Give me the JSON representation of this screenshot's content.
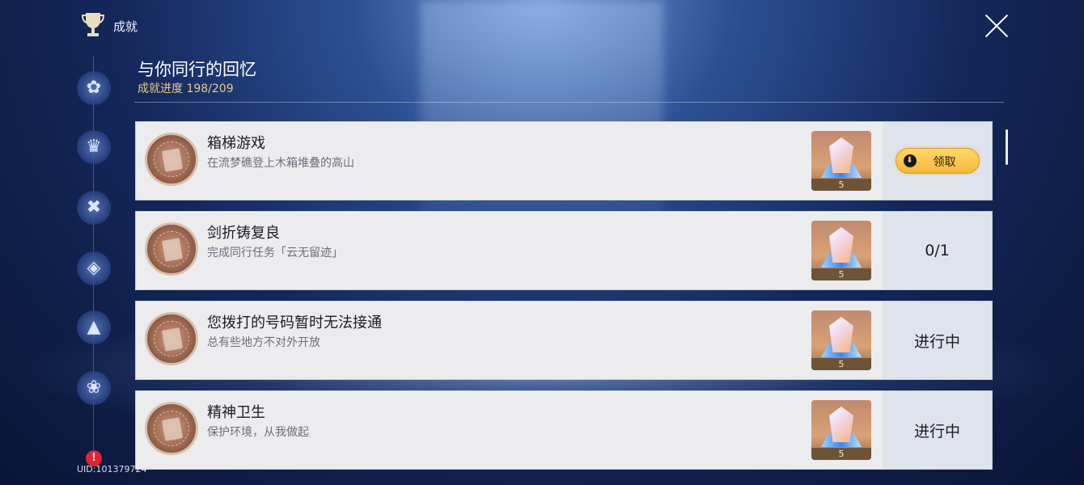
{
  "header": {
    "title": "成就",
    "category_title": "与你同行的回忆",
    "progress": "成就进度 198/209"
  },
  "achievements": [
    {
      "name": "箱梯游戏",
      "desc": "在流梦礁登上木箱堆叠的高山",
      "reward_count": "5",
      "status": "",
      "claim_label": "领取"
    },
    {
      "name": "剑折铸复良",
      "desc": "完成同行任务「云无留迹」",
      "reward_count": "5",
      "status": "0/1"
    },
    {
      "name": "您拨打的号码暂时无法接通",
      "desc": "总有些地方不对外开放",
      "reward_count": "5",
      "status": "进行中"
    },
    {
      "name": "精神卫生",
      "desc": "保护环境，从我做起",
      "reward_count": "5",
      "status": "进行中"
    }
  ],
  "footer": {
    "uid": "UID:101379724",
    "alert_glyph": "!"
  },
  "colors": {
    "progress_gold": "#e8c98a",
    "claim_button": "#f3b83a",
    "alert_red": "#e0242f"
  }
}
